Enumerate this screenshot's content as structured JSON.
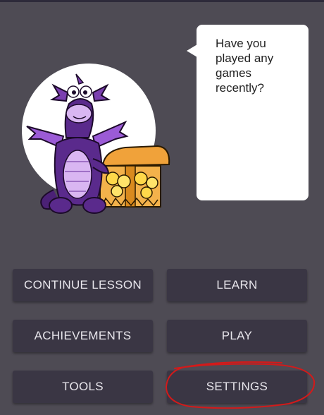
{
  "speech_bubble": {
    "text": "Have you played any games recently?"
  },
  "menu": {
    "continue_lesson": "CONTINUE LESSON",
    "learn": "LEARN",
    "achievements": "ACHIEVEMENTS",
    "play": "PLAY",
    "tools": "TOOLS",
    "settings": "SETTINGS"
  },
  "colors": {
    "background": "#4e4b54",
    "button": "#3a3644",
    "button_text": "#e8e6ec",
    "dragon_purple": "#7b3fb0",
    "highlight_annotation": "#d31a1a"
  },
  "icons": {
    "mascot": "purple-dragon-with-treasure-chest"
  }
}
